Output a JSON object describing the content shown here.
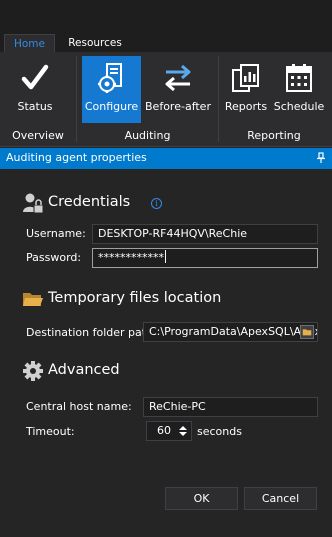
{
  "tabs": [
    {
      "label": "Home",
      "active": true
    },
    {
      "label": "Resources",
      "active": false
    }
  ],
  "ribbon": {
    "buttons": {
      "status": {
        "label": "Status",
        "icon": "checkmark-icon"
      },
      "configure": {
        "label": "Configure",
        "icon": "server-gear-icon",
        "active": true
      },
      "before_after": {
        "label": "Before-after",
        "icon": "swap-arrows-icon"
      },
      "reports": {
        "label": "Reports",
        "icon": "report-documents-icon"
      },
      "schedule": {
        "label": "Schedule",
        "icon": "calendar-icon"
      }
    },
    "groups": {
      "overview": "Overview",
      "auditing": "Auditing",
      "reporting": "Reporting"
    }
  },
  "panel": {
    "title": "Auditing agent properties",
    "credentials": {
      "title": "Credentials",
      "info_glyph": "i",
      "username_label": "Username:",
      "username_value": "DESKTOP-RF44HQV\\ReChie",
      "password_label": "Password:",
      "password_value": "************"
    },
    "temp_files": {
      "title": "Temporary files location",
      "destination_label": "Destination folder path:",
      "destination_value": "C:\\ProgramData\\ApexSQL\\Apex"
    },
    "advanced": {
      "title": "Advanced",
      "host_label": "Central host name:",
      "host_value": "ReChie-PC",
      "timeout_label": "Timeout:",
      "timeout_value": "60",
      "timeout_unit": "seconds"
    },
    "ok_label": "OK",
    "cancel_label": "Cancel"
  },
  "colors": {
    "accent": "#007acc",
    "active_button": "#1579d2",
    "tab_text_active": "#2f8ce8",
    "background": "#252526",
    "folder_icon": "#e8b04a"
  }
}
